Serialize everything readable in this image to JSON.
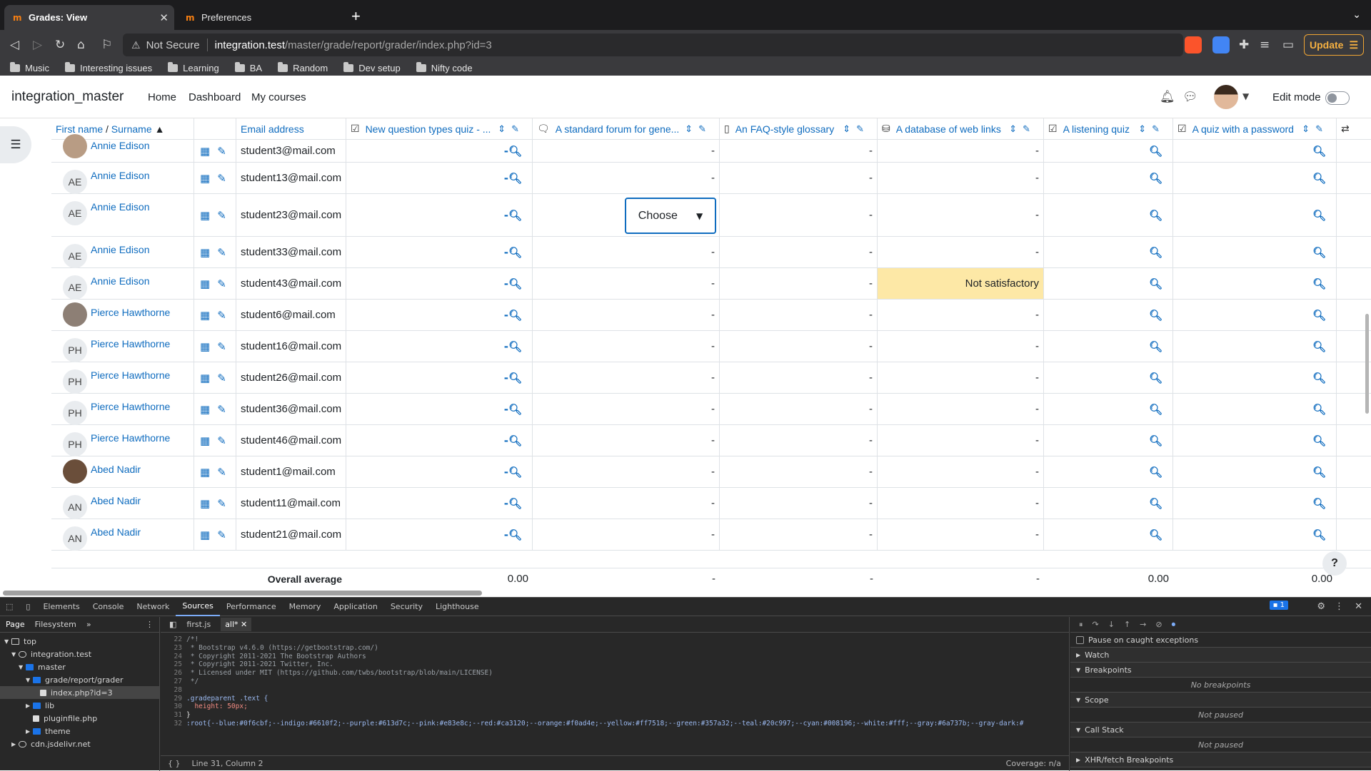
{
  "browser": {
    "tabs": [
      {
        "label": "Grades: View",
        "active": true
      },
      {
        "label": "Preferences",
        "active": false
      }
    ],
    "security_label": "Not Secure",
    "url_host": "integration.test",
    "url_path": "/master/grade/report/grader/index.php?id=3",
    "update_label": "Update",
    "bookmarks": [
      "Music",
      "Interesting issues",
      "Learning",
      "BA",
      "Random",
      "Dev setup",
      "Nifty code"
    ]
  },
  "navbar": {
    "site_name": "integration_master",
    "links": [
      "Home",
      "Dashboard",
      "My courses"
    ],
    "edit_mode_label": "Edit mode"
  },
  "table": {
    "headers": {
      "name_first": "First name",
      "name_sep": " / ",
      "name_last": "Surname",
      "email": "Email address",
      "items": [
        "New question types quiz - ...",
        "A standard forum for gene...",
        "An FAQ-style glossary",
        "A database of web links",
        "A listening quiz",
        "A quiz with a password"
      ]
    },
    "rows": [
      {
        "name": "Annie Edison",
        "initials": "",
        "email": "student3@mail.com",
        "forum": "-",
        "glossary": "-",
        "database": "-"
      },
      {
        "name": "Annie Edison",
        "initials": "AE",
        "email": "student13@mail.com",
        "forum": "-",
        "glossary": "-",
        "database": "-"
      },
      {
        "name": "Annie Edison",
        "initials": "AE",
        "email": "student23@mail.com",
        "forum": "",
        "glossary": "-",
        "database": "-"
      },
      {
        "name": "Annie Edison",
        "initials": "AE",
        "email": "student33@mail.com",
        "forum": "-",
        "glossary": "-",
        "database": "-"
      },
      {
        "name": "Annie Edison",
        "initials": "AE",
        "email": "student43@mail.com",
        "forum": "-",
        "glossary": "-",
        "database": "Not satisfactory"
      },
      {
        "name": "Pierce Hawthorne",
        "initials": "",
        "email": "student6@mail.com",
        "forum": "-",
        "glossary": "-",
        "database": "-"
      },
      {
        "name": "Pierce Hawthorne",
        "initials": "PH",
        "email": "student16@mail.com",
        "forum": "-",
        "glossary": "-",
        "database": "-"
      },
      {
        "name": "Pierce Hawthorne",
        "initials": "PH",
        "email": "student26@mail.com",
        "forum": "-",
        "glossary": "-",
        "database": "-"
      },
      {
        "name": "Pierce Hawthorne",
        "initials": "PH",
        "email": "student36@mail.com",
        "forum": "-",
        "glossary": "-",
        "database": "-"
      },
      {
        "name": "Pierce Hawthorne",
        "initials": "PH",
        "email": "student46@mail.com",
        "forum": "-",
        "glossary": "-",
        "database": "-"
      },
      {
        "name": "Abed Nadir",
        "initials": "",
        "email": "student1@mail.com",
        "forum": "-",
        "glossary": "-",
        "database": "-"
      },
      {
        "name": "Abed Nadir",
        "initials": "AN",
        "email": "student11@mail.com",
        "forum": "-",
        "glossary": "-",
        "database": "-"
      },
      {
        "name": "Abed Nadir",
        "initials": "AN",
        "email": "student21@mail.com",
        "forum": "-",
        "glossary": "-",
        "database": "-"
      }
    ],
    "dropdown_value": "Choose",
    "average": {
      "label": "Overall average",
      "values": [
        "0.00",
        "-",
        "-",
        "-",
        "0.00",
        "0.00"
      ]
    },
    "help_label": "?"
  },
  "devtools": {
    "tabs": [
      "Elements",
      "Console",
      "Network",
      "Sources",
      "Performance",
      "Memory",
      "Application",
      "Security",
      "Lighthouse"
    ],
    "active_tab": "Sources",
    "issue_count": "1",
    "nav_tabs": [
      "Page",
      "Filesystem"
    ],
    "tree": [
      {
        "label": "top",
        "depth": 0
      },
      {
        "label": "integration.test",
        "depth": 1
      },
      {
        "label": "master",
        "depth": 2
      },
      {
        "label": "grade/report/grader",
        "depth": 3
      },
      {
        "label": "index.php?id=3",
        "depth": 4
      },
      {
        "label": "lib",
        "depth": 3
      },
      {
        "label": "pluginfile.php",
        "depth": 3
      },
      {
        "label": "theme",
        "depth": 3
      },
      {
        "label": "cdn.jsdelivr.net",
        "depth": 1
      }
    ],
    "file_tabs": [
      "first.js",
      "all*"
    ],
    "code_lines": [
      {
        "n": "23",
        "text": " * Bootstrap v4.6.0 (https://getbootstrap.com/)"
      },
      {
        "n": "24",
        "text": " * Copyright 2011-2021 The Bootstrap Authors"
      },
      {
        "n": "25",
        "text": " * Copyright 2011-2021 Twitter, Inc."
      },
      {
        "n": "26",
        "text": " * Licensed under MIT (https://github.com/twbs/bootstrap/blob/main/LICENSE)"
      },
      {
        "n": "27",
        "text": " */"
      },
      {
        "n": "28",
        "text": ""
      },
      {
        "n": "29",
        "text": ".gradeparent .text {"
      },
      {
        "n": "30",
        "text": "  height: 50px;"
      },
      {
        "n": "31",
        "text": "}"
      },
      {
        "n": "32",
        "text": ":root{--blue:#0f6cbf;--indigo:#6610f2;--purple:#613d7c;--pink:#e83e8c;--red:#ca3120;--orange:#f0ad4e;--yellow:#ff7518;--green:#357a32;--teal:#20c997;--cyan:#008196;--white:#fff;--gray:#6a737b;--gray-dark:#"
      }
    ],
    "status_position": "Line 31, Column 2",
    "coverage": "Coverage: n/a",
    "pause_label": "Pause on caught exceptions",
    "panes": [
      {
        "title": "Watch",
        "body": ""
      },
      {
        "title": "Breakpoints",
        "body": "No breakpoints"
      },
      {
        "title": "Scope",
        "body": "Not paused"
      },
      {
        "title": "Call Stack",
        "body": "Not paused"
      },
      {
        "title": "XHR/fetch Breakpoints",
        "body": ""
      }
    ]
  }
}
